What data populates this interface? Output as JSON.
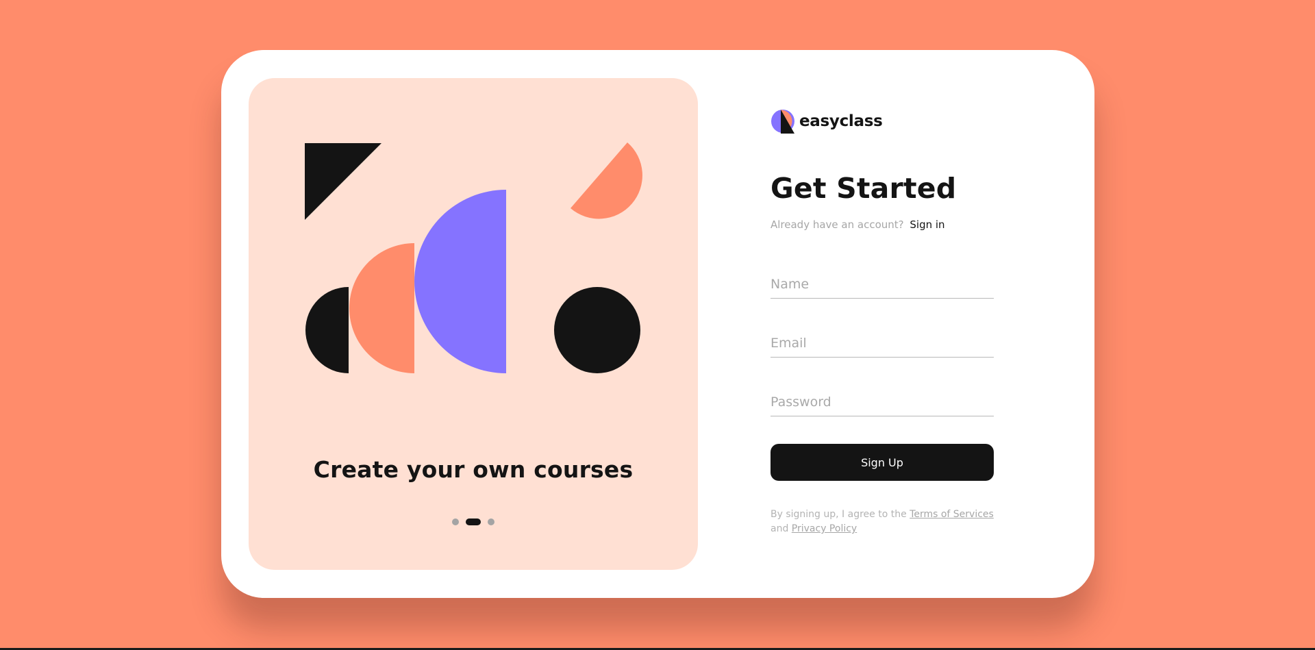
{
  "brand": {
    "name": "easyclass"
  },
  "slider": {
    "caption": "Create your own courses",
    "dots": [
      {
        "active": false
      },
      {
        "active": true
      },
      {
        "active": false
      }
    ]
  },
  "form": {
    "title": "Get Started",
    "signin_prompt": "Already have an account?",
    "signin_link": "Sign in",
    "name_placeholder": "Name",
    "email_placeholder": "Email",
    "password_placeholder": "Password",
    "submit_label": "Sign Up",
    "legal_prefix": "By signing up, I agree to the",
    "terms_link": "Terms of Services",
    "legal_and": "and",
    "privacy_link": "Privacy Policy"
  },
  "colors": {
    "background": "#ff8c6b",
    "card": "#ffffff",
    "panel": "#ffe0d3",
    "dark": "#141414",
    "coral": "#ff8c6b",
    "purple": "#8573ff",
    "muted": "#a6a6a6"
  }
}
